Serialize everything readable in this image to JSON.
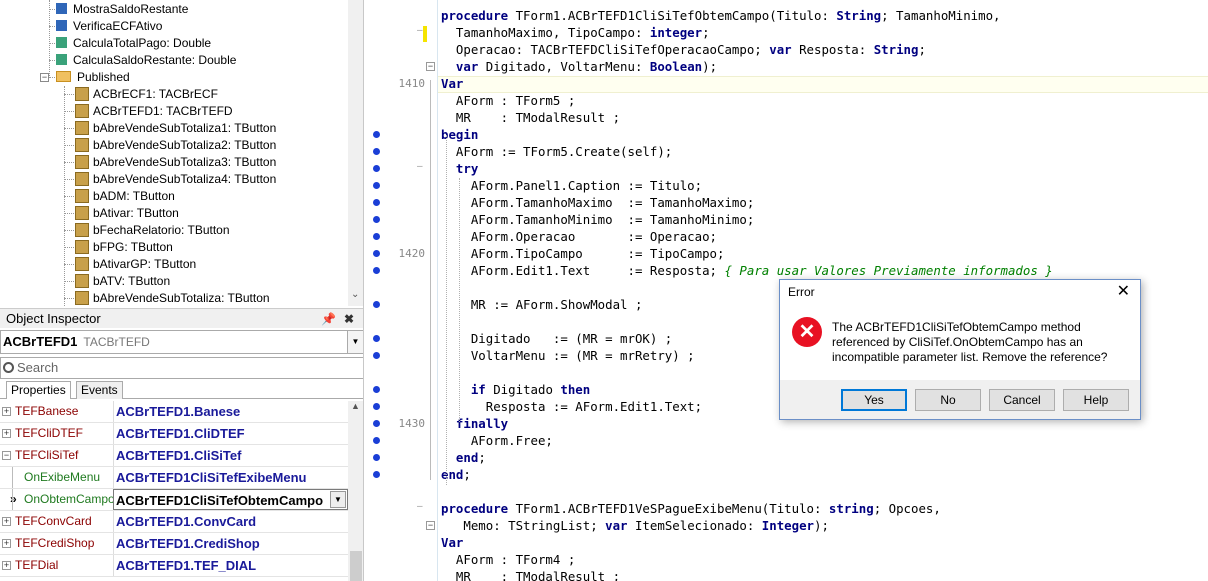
{
  "tree": {
    "items": [
      {
        "label": "MostraSaldoRestante",
        "icon": "method-blue"
      },
      {
        "label": "VerificaECFAtivo",
        "icon": "method-blue"
      },
      {
        "label": "CalculaTotalPago: Double",
        "icon": "function-teal"
      },
      {
        "label": "CalculaSaldoRestante: Double",
        "icon": "function-teal"
      },
      {
        "label": "Published",
        "icon": "folder"
      },
      {
        "label": "ACBrECF1: TACBrECF",
        "icon": "component"
      },
      {
        "label": "ACBrTEFD1: TACBrTEFD",
        "icon": "component"
      },
      {
        "label": "bAbreVendeSubTotaliza1: TButton",
        "icon": "component"
      },
      {
        "label": "bAbreVendeSubTotaliza2: TButton",
        "icon": "component"
      },
      {
        "label": "bAbreVendeSubTotaliza3: TButton",
        "icon": "component"
      },
      {
        "label": "bAbreVendeSubTotaliza4: TButton",
        "icon": "component"
      },
      {
        "label": "bADM: TButton",
        "icon": "component"
      },
      {
        "label": "bAtivar: TButton",
        "icon": "component"
      },
      {
        "label": "bFechaRelatorio: TButton",
        "icon": "component"
      },
      {
        "label": "bFPG: TButton",
        "icon": "component"
      },
      {
        "label": "bAtivarGP: TButton",
        "icon": "component"
      },
      {
        "label": "bATV: TButton",
        "icon": "component"
      },
      {
        "label": "bAbreVendeSubTotaliza: TButton",
        "icon": "component"
      }
    ]
  },
  "inspector": {
    "title": "Object Inspector",
    "object_name": "ACBrTEFD1",
    "object_type": "TACBrTEFD",
    "search_placeholder": "Search",
    "tabs": [
      "Properties",
      "Events"
    ],
    "rows": [
      {
        "name": "TEFBanese",
        "value": "ACBrTEFD1.Banese",
        "expander": "+"
      },
      {
        "name": "TEFCliDTEF",
        "value": "ACBrTEFD1.CliDTEF",
        "expander": "+"
      },
      {
        "name": "TEFCliSiTef",
        "value": "ACBrTEFD1.CliSiTef",
        "expander": "-"
      },
      {
        "name": "OnExibeMenu",
        "value": "ACBrTEFD1CliSiTefExibeMenu",
        "expander": ""
      },
      {
        "name": "OnObtemCampo",
        "value": "ACBrTEFD1CliSiTefObtemCampo",
        "expander": ""
      },
      {
        "name": "TEFConvCard",
        "value": "ACBrTEFD1.ConvCard",
        "expander": "+"
      },
      {
        "name": "TEFCrediShop",
        "value": "ACBrTEFD1.CrediShop",
        "expander": "+"
      },
      {
        "name": "TEFDial",
        "value": "ACBrTEFD1.TEF_DIAL",
        "expander": "+"
      }
    ]
  },
  "gutter": {
    "line_numbers": [
      "1410",
      "1420",
      "1430"
    ]
  },
  "code": {
    "lines": [
      "procedure TForm1.ACBrTEFD1CliSiTefObtemCampo(Titulo: String; TamanhoMinimo,",
      "  TamanhoMaximo, TipoCampo: integer;",
      "  Operacao: TACBrTEFDCliSiTefOperacaoCampo; var Resposta: String;",
      "  var Digitado, VoltarMenu: Boolean);",
      "Var",
      "  AForm : TForm5 ;",
      "  MR    : TModalResult ;",
      "begin",
      "  AForm := TForm5.Create(self);",
      "  try",
      "    AForm.Panel1.Caption := Titulo;",
      "    AForm.TamanhoMaximo  := TamanhoMaximo;",
      "    AForm.TamanhoMinimo  := TamanhoMinimo;",
      "    AForm.Operacao       := Operacao;",
      "    AForm.TipoCampo      := TipoCampo;",
      "    AForm.Edit1.Text     := Resposta; { Para usar Valores Previamente informados }",
      "",
      "    MR := AForm.ShowModal ;",
      "",
      "    Digitado   := (MR = mrOK) ;",
      "    VoltarMenu := (MR = mrRetry) ;",
      "",
      "    if Digitado then",
      "      Resposta := AForm.Edit1.Text;",
      "  finally",
      "    AForm.Free;",
      "  end;",
      "end;",
      "",
      "procedure TForm1.ACBrTEFD1VeSPagueExibeMenu(Titulo: string; Opcoes,",
      "   Memo: TStringList; var ItemSelecionado: Integer);",
      "Var",
      "  AForm : TForm4 ;",
      "  MR    : TModalResult ;"
    ]
  },
  "dialog": {
    "title": "Error",
    "message": "The ACBrTEFD1CliSiTefObtemCampo method referenced by CliSiTef.OnObtemCampo has an incompatible parameter list. Remove the reference?",
    "buttons": [
      "Yes",
      "No",
      "Cancel",
      "Help"
    ]
  }
}
